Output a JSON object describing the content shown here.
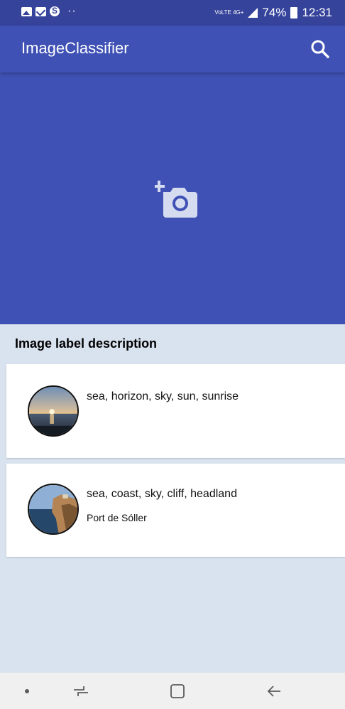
{
  "status_bar": {
    "network_label": "VoLTE 4G+",
    "battery": "74%",
    "time": "12:31",
    "left_icons": [
      "gallery-icon",
      "mail-icon",
      "skype-icon"
    ],
    "overflow": "··"
  },
  "app_bar": {
    "title": "ImageClassifier",
    "action_icon": "search-icon",
    "background_color": "#3f51b5"
  },
  "hero": {
    "icon": "add-photo-icon",
    "background_color": "#3f51b5"
  },
  "section": {
    "title": "Image label description",
    "background_color": "#d9e3ef"
  },
  "items": [
    {
      "labels": "sea, horizon, sky, sun, sunrise",
      "location": ""
    },
    {
      "labels": "sea, coast, sky, cliff, headland",
      "location": "Port de Sóller"
    }
  ],
  "nav_bar": {
    "buttons": [
      "dot-indicator",
      "recent-apps",
      "home",
      "back"
    ]
  }
}
